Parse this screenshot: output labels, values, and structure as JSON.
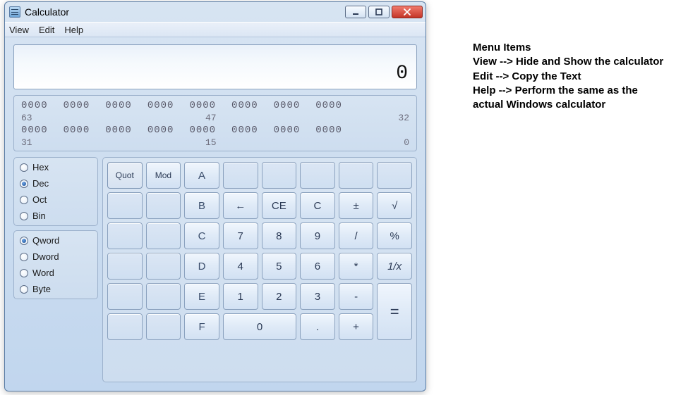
{
  "window": {
    "title": "Calculator"
  },
  "menu": {
    "view": "View",
    "edit": "Edit",
    "help": "Help"
  },
  "display": {
    "value": "0"
  },
  "bits": {
    "rows": [
      "0000",
      "0000",
      "0000",
      "0000",
      "0000",
      "0000",
      "0000",
      "0000"
    ],
    "labels": {
      "l1": "63",
      "m1": "47",
      "r1": "32",
      "l2": "31",
      "m2": "15",
      "r2": "0"
    }
  },
  "base": {
    "hex": "Hex",
    "dec": "Dec",
    "oct": "Oct",
    "bin": "Bin",
    "selected": "dec"
  },
  "word": {
    "qword": "Qword",
    "dword": "Dword",
    "word": "Word",
    "byte": "Byte",
    "selected": "qword"
  },
  "keys": {
    "quot": "Quot",
    "mod": "Mod",
    "A": "A",
    "B": "B",
    "C_hex": "C",
    "D": "D",
    "E": "E",
    "F": "F",
    "back": "←",
    "CE": "CE",
    "C": "C",
    "pm": "±",
    "sqrt": "√",
    "7": "7",
    "8": "8",
    "9": "9",
    "div": "/",
    "pct": "%",
    "4": "4",
    "5": "5",
    "6": "6",
    "mul": "*",
    "recip": "1/x",
    "1": "1",
    "2": "2",
    "3": "3",
    "sub": "-",
    "0": "0",
    "dot": ".",
    "add": "+",
    "eq": "="
  },
  "annot": {
    "title": "Menu Items",
    "l1": "View --> Hide and Show the calculator",
    "l2": "Edit --> Copy the Text",
    "l3": "Help --> Perform the same as the",
    "l4": "actual Windows calculator"
  }
}
